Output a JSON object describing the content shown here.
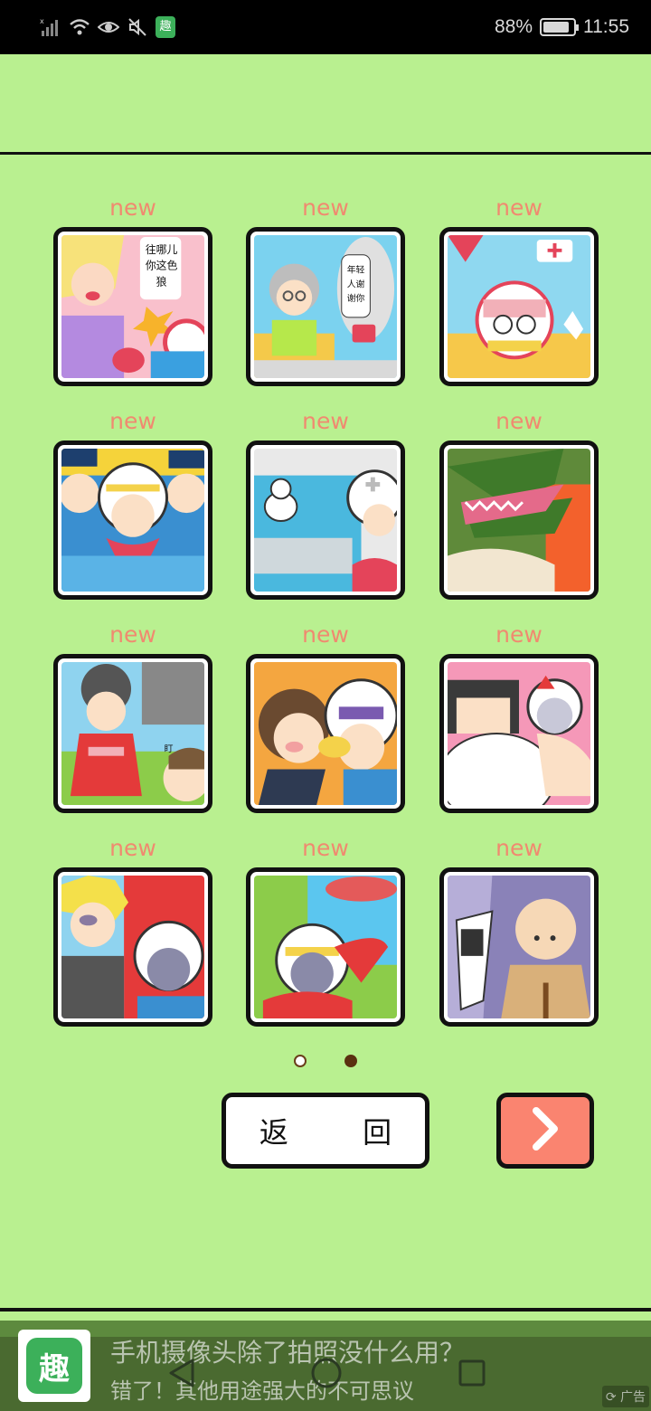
{
  "status_bar": {
    "battery": "88%",
    "battery_level": 0.88,
    "time": "11:55",
    "icons": [
      "signal-icon",
      "wifi-icon",
      "eye-icon",
      "mute-icon",
      "app-notification-icon"
    ],
    "notification_app_glyph": "趣"
  },
  "grid": {
    "badge": "new",
    "items": [
      {
        "name": "level-1",
        "badge": "new",
        "speech": "你这色狼 往哪儿摸呢"
      },
      {
        "name": "level-2",
        "badge": "new",
        "speech": "年轻人谢谢你啊"
      },
      {
        "name": "level-3",
        "badge": "new"
      },
      {
        "name": "level-4",
        "badge": "new"
      },
      {
        "name": "level-5",
        "badge": "new"
      },
      {
        "name": "level-6",
        "badge": "new"
      },
      {
        "name": "level-7",
        "badge": "new",
        "speech": "盯"
      },
      {
        "name": "level-8",
        "badge": "new"
      },
      {
        "name": "level-9",
        "badge": "new"
      },
      {
        "name": "level-10",
        "badge": "new"
      },
      {
        "name": "level-11",
        "badge": "new"
      },
      {
        "name": "level-12",
        "badge": "new"
      }
    ]
  },
  "pagination": {
    "pages": 2,
    "current": 2
  },
  "buttons": {
    "back_label": "返 回",
    "next_icon": "chevron-right-icon"
  },
  "ad": {
    "app_icon_glyph": "趣",
    "title": "手机摄像头除了拍照没什么用？",
    "subtitle": "错了！其他用途强大的不可思议",
    "badge": "广告"
  },
  "nav_bar": {
    "icons": [
      "back-icon",
      "home-icon",
      "recent-apps-icon"
    ]
  },
  "colors": {
    "background": "#b9f090",
    "badge_text": "#f08a70",
    "next_button": "#fa8470",
    "frame": "#111111"
  }
}
